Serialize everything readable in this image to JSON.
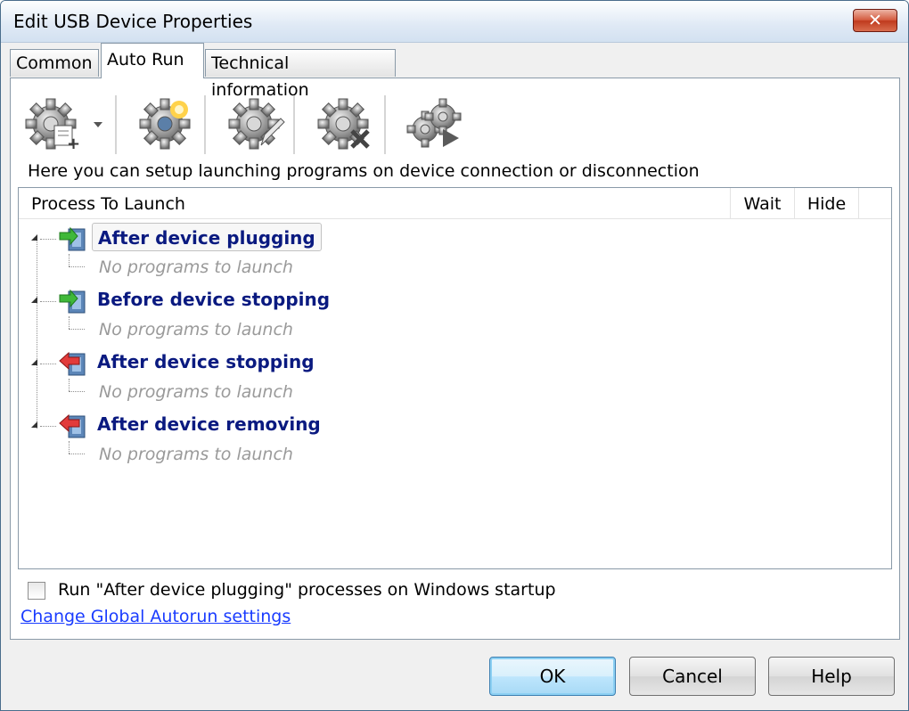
{
  "window": {
    "title": "Edit USB Device Properties",
    "close_label": "✕"
  },
  "tabs": [
    {
      "label": "Common"
    },
    {
      "label": "Auto Run"
    },
    {
      "label": "Technical information"
    }
  ],
  "toolbar": {
    "items": [
      {
        "icon": "add-process-gear-icon",
        "has_dropdown": true
      },
      {
        "icon": "new-process-gear-icon"
      },
      {
        "icon": "edit-process-gear-icon"
      },
      {
        "icon": "delete-process-gear-icon"
      },
      {
        "icon": "run-process-gear-icon"
      }
    ]
  },
  "description": "Here you can setup launching programs on device connection or disconnection",
  "tree": {
    "columns": [
      "Process To Launch",
      "Wait",
      "Hide"
    ],
    "nodes": [
      {
        "label": "After device plugging",
        "child": "No programs to launch",
        "arrow": "green",
        "selected": true
      },
      {
        "label": "Before device stopping",
        "child": "No programs to launch",
        "arrow": "green",
        "selected": false
      },
      {
        "label": "After device stopping",
        "child": "No programs to launch",
        "arrow": "red",
        "selected": false
      },
      {
        "label": "After device removing",
        "child": "No programs to launch",
        "arrow": "red",
        "selected": false
      }
    ]
  },
  "startup_checkbox": {
    "label": "Run \"After device plugging\" processes on Windows startup",
    "checked": false
  },
  "global_link": "Change Global Autorun settings",
  "buttons": {
    "ok": "OK",
    "cancel": "Cancel",
    "help": "Help"
  },
  "colors": {
    "node_text": "#0a1a80",
    "link": "#1a3cff",
    "child_text": "#9a9a9a"
  }
}
